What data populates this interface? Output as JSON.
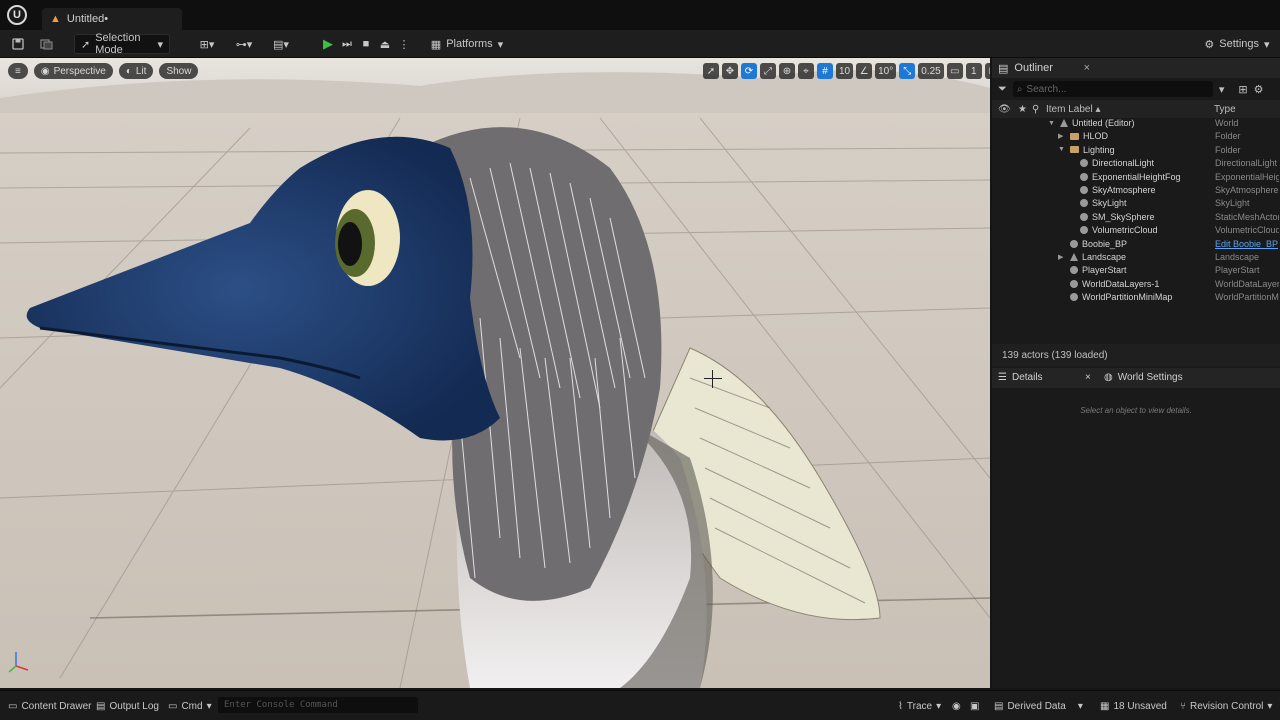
{
  "window": {
    "tab_title": "Untitled•",
    "logo": "U"
  },
  "toolbar": {
    "mode_label": "Selection Mode",
    "platforms_label": "Platforms",
    "settings_label": "Settings"
  },
  "viewport": {
    "perspective_label": "Perspective",
    "lit_label": "Lit",
    "show_label": "Show",
    "grid_snap": "10",
    "rotation_snap": "10°",
    "scale_snap": "0.25",
    "camera_speed": "1",
    "accent_color": "#1e78d6"
  },
  "outliner": {
    "title": "Outliner",
    "search_placeholder": "Search...",
    "col_label": "Item Label ▴",
    "col_type": "Type",
    "items": [
      {
        "label": "Untitled (Editor)",
        "type": "World",
        "icon": "world-icon",
        "indent": 0,
        "arrow": "▼"
      },
      {
        "label": "HLOD",
        "type": "Folder",
        "icon": "folder-icon",
        "indent": 1,
        "arrow": "▶"
      },
      {
        "label": "Lighting",
        "type": "Folder",
        "icon": "folder-icon",
        "indent": 1,
        "arrow": "▼"
      },
      {
        "label": "DirectionalLight",
        "type": "DirectionalLight",
        "icon": "light-icon",
        "indent": 2,
        "arrow": ""
      },
      {
        "label": "ExponentialHeightFog",
        "type": "ExponentialHeig",
        "icon": "fog-icon",
        "indent": 2,
        "arrow": ""
      },
      {
        "label": "SkyAtmosphere",
        "type": "SkyAtmosphere",
        "icon": "atmosphere-icon",
        "indent": 2,
        "arrow": ""
      },
      {
        "label": "SkyLight",
        "type": "SkyLight",
        "icon": "skylight-icon",
        "indent": 2,
        "arrow": ""
      },
      {
        "label": "SM_SkySphere",
        "type": "StaticMeshActor",
        "icon": "mesh-icon",
        "indent": 2,
        "arrow": ""
      },
      {
        "label": "VolumetricCloud",
        "type": "VolumetricCloud",
        "icon": "cloud-icon",
        "indent": 2,
        "arrow": ""
      },
      {
        "label": "Boobie_BP",
        "type": "Edit Boobie_BP",
        "icon": "actor-icon",
        "indent": 1,
        "arrow": "",
        "link": true
      },
      {
        "label": "Landscape",
        "type": "Landscape",
        "icon": "landscape-icon",
        "indent": 1,
        "arrow": "▶"
      },
      {
        "label": "PlayerStart",
        "type": "PlayerStart",
        "icon": "player-start-icon",
        "indent": 1,
        "arrow": ""
      },
      {
        "label": "WorldDataLayers-1",
        "type": "WorldDataLayer",
        "icon": "data-layer-icon",
        "indent": 1,
        "arrow": ""
      },
      {
        "label": "WorldPartitionMiniMap",
        "type": "WorldPartitionM",
        "icon": "minimap-icon",
        "indent": 1,
        "arrow": ""
      }
    ],
    "footer": "139 actors (139 loaded)"
  },
  "details": {
    "tab_details": "Details",
    "tab_world_settings": "World Settings",
    "empty_message": "Select an object to view details."
  },
  "statusbar": {
    "content_drawer": "Content Drawer",
    "output_log": "Output Log",
    "cmd": "Cmd",
    "console_placeholder": "Enter Console Command",
    "trace": "Trace",
    "derived_data": "Derived Data",
    "unsaved": "18 Unsaved",
    "revision_control": "Revision Control"
  }
}
